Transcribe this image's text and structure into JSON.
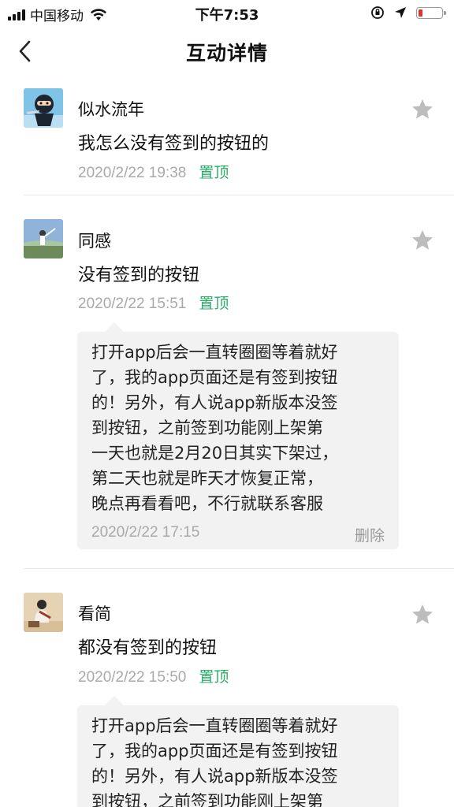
{
  "status_bar": {
    "carrier": "中国移动",
    "time": "下午7:53",
    "battery_level": 0.2,
    "battery_color": "#e0322e"
  },
  "nav": {
    "title": "互动详情",
    "back_icon": "chevron-left-icon"
  },
  "colors": {
    "accent_green": "#2aae67",
    "meta_gray": "#a9a9a9",
    "bubble_bg": "#f2f2f2"
  },
  "comments": [
    {
      "author": "似水流年",
      "text": "我怎么没有签到的按钮的",
      "time": "2020/2/22 19:38",
      "pin_label": "置顶",
      "avatar_icon": "ninja-avatar"
    },
    {
      "author": "同感",
      "text": "没有签到的按钮",
      "time": "2020/2/22 15:51",
      "pin_label": "置顶",
      "avatar_icon": "outdoor-photo-avatar",
      "reply": {
        "lines": [
          "打开app后会一直转圈圈等着就好",
          "了，我的app页面还是有签到按钮",
          "的！另外，有人说app新版本没签",
          "到按钮，之前签到功能刚上架第",
          "一天也就是2月20日其实下架过，",
          "第二天也就是昨天才恢复正常，",
          "晚点再看看吧，不行就联系客服"
        ],
        "time": "2020/2/22 17:15",
        "delete_label": "删除"
      }
    },
    {
      "author": "看简",
      "text": "都没有签到的按钮",
      "time": "2020/2/22 15:50",
      "pin_label": "置顶",
      "avatar_icon": "painting-avatar",
      "reply": {
        "lines": [
          "打开app后会一直转圈圈等着就好",
          "了，我的app页面还是有签到按钮",
          "的！另外，有人说app新版本没签",
          "到按钮，之前签到功能刚上架第"
        ]
      }
    }
  ]
}
